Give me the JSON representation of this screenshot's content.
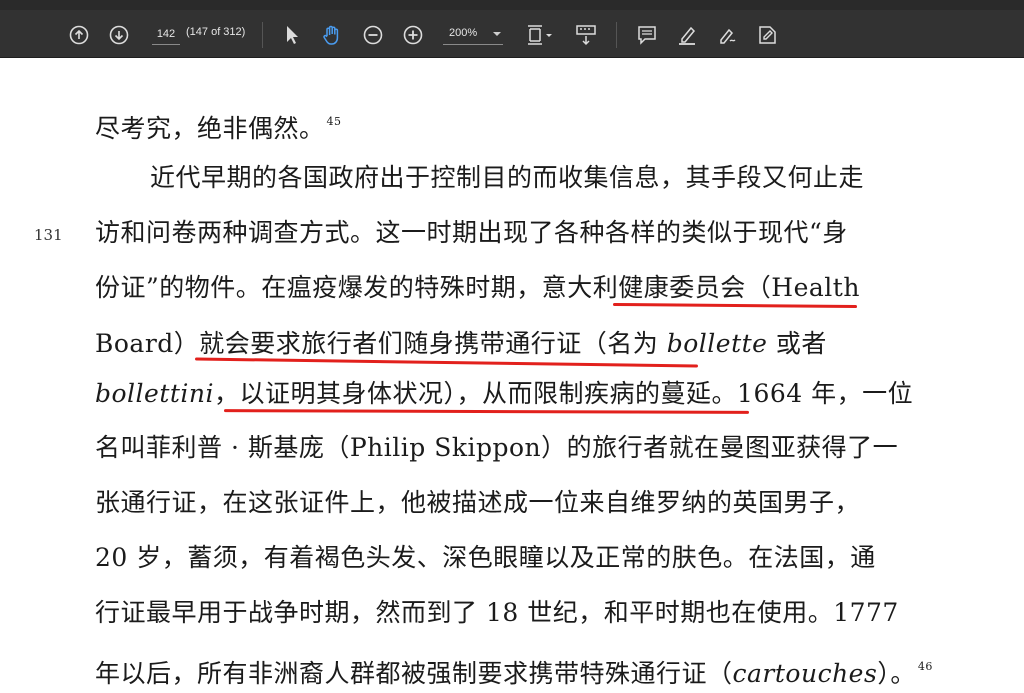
{
  "toolbar": {
    "page_current": "142",
    "page_count": "(147 of 312)",
    "zoom": "200%",
    "icons": [
      "up-arrow-icon",
      "down-arrow-icon",
      "select-cursor-icon",
      "hand-icon",
      "zoom-out-icon",
      "zoom-in-icon",
      "page-fit-icon",
      "scroll-mode-icon",
      "comment-icon",
      "highlight-icon",
      "draw-icon",
      "sign-icon"
    ]
  },
  "document": {
    "margin_number": "131",
    "lines": [
      {
        "id": "l1",
        "text": "尽考究，绝非偶然。",
        "sup": "45"
      },
      {
        "id": "l2",
        "text": "近代早期的各国政府出于控制目的而收集信息，其手段又何止走"
      },
      {
        "id": "l3",
        "text": "访和问卷两种调查方式。这一时期出现了各种各样的类似于现代“身"
      },
      {
        "id": "l4",
        "text": "份证”的物件。在瘟疫爆发的特殊时期，意大利健康委员会（Health"
      },
      {
        "id": "l5a",
        "text": "Board）就会要求旅行者们随身携带通行证（名为 "
      },
      {
        "id": "l5b",
        "text": "bollette"
      },
      {
        "id": "l5c",
        "text": " 或者"
      },
      {
        "id": "l6a",
        "text": "bollettini"
      },
      {
        "id": "l6b",
        "text": "，以证明其身体状况），从而限制疾病的蔓延。1664 年，一位"
      },
      {
        "id": "l7",
        "text": "名叫菲利普 · 斯基庞（Philip Skippon）的旅行者就在曼图亚获得了一"
      },
      {
        "id": "l8",
        "text": "张通行证，在这张证件上，他被描述成一位来自维罗纳的英国男子，"
      },
      {
        "id": "l9",
        "text": "20 岁，蓄须，有着褐色头发、深色眼瞳以及正常的肤色。在法国，通"
      },
      {
        "id": "l10",
        "text": "行证最早用于战争时期，然而到了 18 世纪，和平时期也在使用。1777"
      },
      {
        "id": "l11a",
        "text": "年以后，所有非洲裔人群都被强制要求携带特殊通行证（"
      },
      {
        "id": "l11b",
        "text": "cartouches"
      },
      {
        "id": "l11c",
        "text": "）。",
        "sup": "46"
      }
    ],
    "underline_color": "#e2201c"
  }
}
